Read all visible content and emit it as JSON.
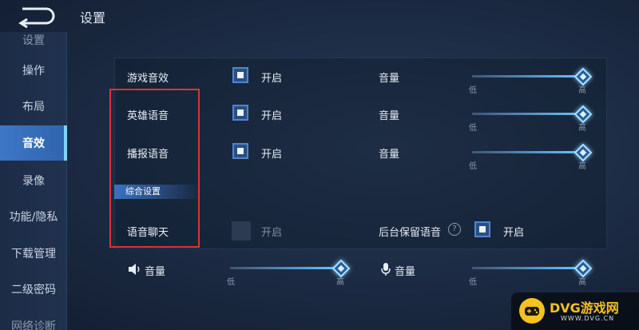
{
  "header": {
    "title": "设置"
  },
  "sidebar": {
    "items": [
      {
        "label": "设置",
        "partial": true
      },
      {
        "label": "操作"
      },
      {
        "label": "布局"
      },
      {
        "label": "音效",
        "active": true
      },
      {
        "label": "录像"
      },
      {
        "label": "功能/隐私"
      },
      {
        "label": "下载管理"
      },
      {
        "label": "二级密码"
      },
      {
        "label": "网络诊断",
        "partial": true
      }
    ]
  },
  "settings": {
    "game_sound": {
      "label": "游戏音效",
      "toggle": "开启",
      "checked": true,
      "volume_label": "音量",
      "volume": 1.0,
      "low": "低",
      "high": "高"
    },
    "hero_voice": {
      "label": "英雄语音",
      "toggle": "开启",
      "checked": true,
      "volume_label": "音量",
      "volume": 1.0,
      "low": "低",
      "high": "高"
    },
    "broadcast_voice": {
      "label": "播报语音",
      "toggle": "开启",
      "checked": true,
      "volume_label": "音量",
      "volume": 1.0,
      "low": "低",
      "high": "高"
    },
    "section": {
      "label": "综合设置"
    },
    "voice_chat": {
      "label": "语音聊天",
      "toggle": "开启",
      "checked": false,
      "background_label": "后台保留语音",
      "background_toggle": "开启",
      "background_checked": true
    },
    "speaker_volume": {
      "label": "音量",
      "volume": 1.0,
      "low": "低",
      "high": "高"
    },
    "mic_volume": {
      "label": "音量",
      "volume": 1.0,
      "low": "低",
      "high": "高"
    }
  },
  "help": {
    "glyph": "?"
  },
  "watermark": {
    "text": "DVG游戏网",
    "sub": "WWW.DVG.CN"
  },
  "colors": {
    "accent": "#3d77c6",
    "highlight": "#e0342a",
    "brand": "#f6c21b"
  }
}
